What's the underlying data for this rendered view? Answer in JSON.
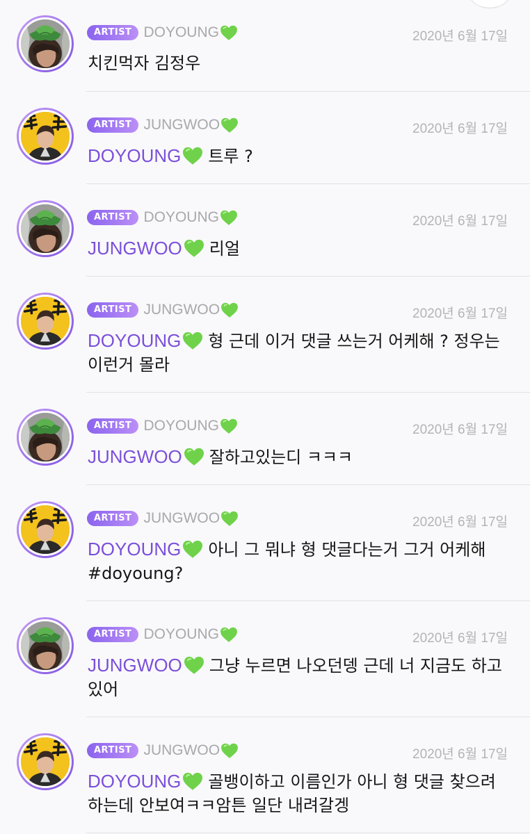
{
  "badge_label": "ARTIST",
  "accent_color": "#7b4fd9",
  "heart_icon": "green-heart-icon",
  "comments": [
    {
      "avatar": "doyoung-avatar",
      "author": "DOYOUNG",
      "date": "2020년 6월 17일",
      "mention": "",
      "text": "치킨먹자 김정우"
    },
    {
      "avatar": "jungwoo-avatar",
      "author": "JUNGWOO",
      "date": "2020년 6월 17일",
      "mention": "DOYOUNG",
      "text": "트루 ?"
    },
    {
      "avatar": "doyoung-avatar",
      "author": "DOYOUNG",
      "date": "2020년 6월 17일",
      "mention": "JUNGWOO",
      "text": "리얼"
    },
    {
      "avatar": "jungwoo-avatar",
      "author": "JUNGWOO",
      "date": "2020년 6월 17일",
      "mention": "DOYOUNG",
      "text": "형 근데 이거 댓글 쓰는거 어케해 ? 정우는 이런거 몰라"
    },
    {
      "avatar": "doyoung-avatar",
      "author": "DOYOUNG",
      "date": "2020년 6월 17일",
      "mention": "JUNGWOO",
      "text": "잘하고있는디 ㅋㅋㅋ"
    },
    {
      "avatar": "jungwoo-avatar",
      "author": "JUNGWOO",
      "date": "2020년 6월 17일",
      "mention": "DOYOUNG",
      "text": "아니 그 뭐냐 형 댓글다는거 그거 어케해 #doyoung?"
    },
    {
      "avatar": "doyoung-avatar",
      "author": "DOYOUNG",
      "date": "2020년 6월 17일",
      "mention": "JUNGWOO",
      "text": "그냥 누르면 나오던뎅  근데 너 지금도 하고있어"
    },
    {
      "avatar": "jungwoo-avatar",
      "author": "JUNGWOO",
      "date": "2020년 6월 17일",
      "mention": "DOYOUNG",
      "text": "골뱅이하고 이름인가 아니 형 댓글 찾으려하는데 안보여ㅋㅋ암튼 일단 내려갈겡"
    }
  ]
}
